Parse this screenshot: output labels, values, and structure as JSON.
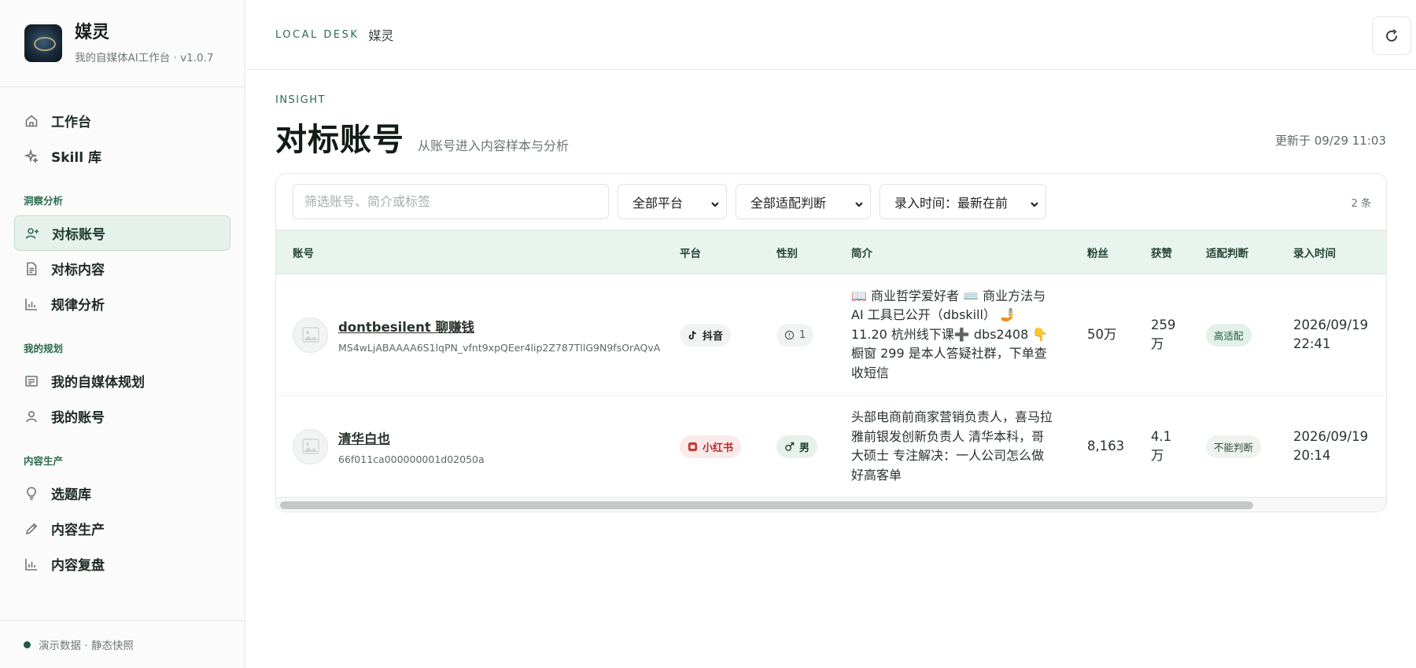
{
  "app": {
    "name": "媒灵",
    "subtitle": "我的自媒体AI工作台 · v1.0.7",
    "top_eyebrow": "LOCAL DESK",
    "top_name": "媒灵"
  },
  "sidebar": {
    "top_items": [
      {
        "label": "工作台",
        "icon": "home-icon"
      },
      {
        "label": "Skill 库",
        "icon": "sparkle-icon"
      }
    ],
    "groups": [
      {
        "title": "洞察分析",
        "items": [
          {
            "label": "对标账号",
            "icon": "user-plus-icon",
            "active": true
          },
          {
            "label": "对标内容",
            "icon": "document-icon"
          },
          {
            "label": "规律分析",
            "icon": "bar-chart-icon"
          }
        ]
      },
      {
        "title": "我的规划",
        "items": [
          {
            "label": "我的自媒体规划",
            "icon": "list-doc-icon"
          },
          {
            "label": "我的账号",
            "icon": "user-icon"
          }
        ]
      },
      {
        "title": "内容生产",
        "items": [
          {
            "label": "选题库",
            "icon": "lightbulb-icon"
          },
          {
            "label": "内容生产",
            "icon": "pencil-icon"
          },
          {
            "label": "内容复盘",
            "icon": "bar-chart-icon"
          }
        ]
      }
    ],
    "footer": "演示数据 · 静态快照"
  },
  "header": {
    "eyebrow": "INSIGHT",
    "title": "对标账号",
    "subtitle": "从账号进入内容样本与分析",
    "updated": "更新于 09/29 11:03"
  },
  "filters": {
    "search_placeholder": "筛选账号、简介或标签",
    "platform": "全部平台",
    "fit": "全部适配判断",
    "sort": "录入时间：最新在前",
    "count": "2 条"
  },
  "table": {
    "columns": [
      "账号",
      "平台",
      "性别",
      "简介",
      "粉丝",
      "获赞",
      "适配判断",
      "录入时间"
    ],
    "rows": [
      {
        "name": "dontbesilent 聊赚钱",
        "id": "MS4wLjABAAAA6S1lqPN_vfnt9xpQEer4lip2Z787TllG9N9fsOrAQvA",
        "platform": "抖音",
        "gender": "1",
        "bio": "📖 商业哲学爱好者 ⌨️ 商业方法与 AI 工具已公开（dbskill） 🤳 11.20 杭州线下课➕ dbs2408 👇 橱窗 299 是本人答疑社群，下单查收短信",
        "fans": "50万",
        "likes": "259 万",
        "fit": "高适配",
        "date": "2026/09/19",
        "time": "22:41"
      },
      {
        "name": "清华白也",
        "id": "66f011ca000000001d02050a",
        "platform": "小红书",
        "gender": "男",
        "bio": "头部电商前商家营销负责人，喜马拉雅前银发创新负责人 清华本科，哥大硕士 专注解决：一人公司怎么做好高客单",
        "fans": "8,163",
        "likes": "4.1 万",
        "fit": "不能判断",
        "date": "2026/09/19",
        "time": "20:14"
      }
    ]
  },
  "colors": {
    "accent": "#2c6b4f",
    "active_bg": "#e6f1eb",
    "table_head_bg": "#eaf4ef",
    "xhs_red": "#b52b2b"
  }
}
